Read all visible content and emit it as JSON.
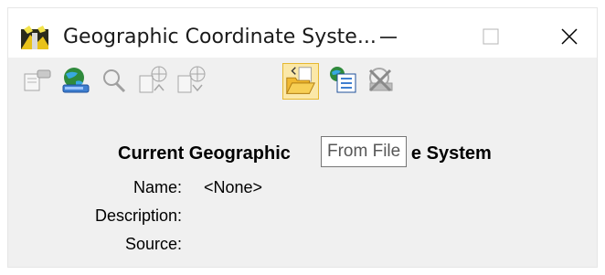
{
  "window": {
    "title": "Geographic Coordinate Syste...",
    "controls": {
      "minimize": "minimize-icon",
      "maximize": "maximize-icon",
      "close": "close-icon"
    }
  },
  "toolbar": {
    "buttons": [
      {
        "name": "edit-icon",
        "active": false
      },
      {
        "name": "globe-disk-icon",
        "active": false
      },
      {
        "name": "search-icon",
        "active": false
      },
      {
        "name": "export-icon",
        "active": false
      },
      {
        "name": "import-icon",
        "active": false
      },
      {
        "name": "from-file-folder-icon",
        "active": true
      },
      {
        "name": "library-icon",
        "active": false
      },
      {
        "name": "delete-icon",
        "active": false
      }
    ]
  },
  "tooltip": {
    "text": "From File"
  },
  "main": {
    "heading_left": "Current Geographic",
    "heading_right": "e System",
    "fields": [
      {
        "label": "Name:",
        "value": "<None>"
      },
      {
        "label": "Description:",
        "value": ""
      },
      {
        "label": "Source:",
        "value": ""
      }
    ]
  },
  "colors": {
    "active_button_bg": "#fbe8a8",
    "active_button_border": "#e6b830",
    "tooltip_border": "#767676"
  }
}
